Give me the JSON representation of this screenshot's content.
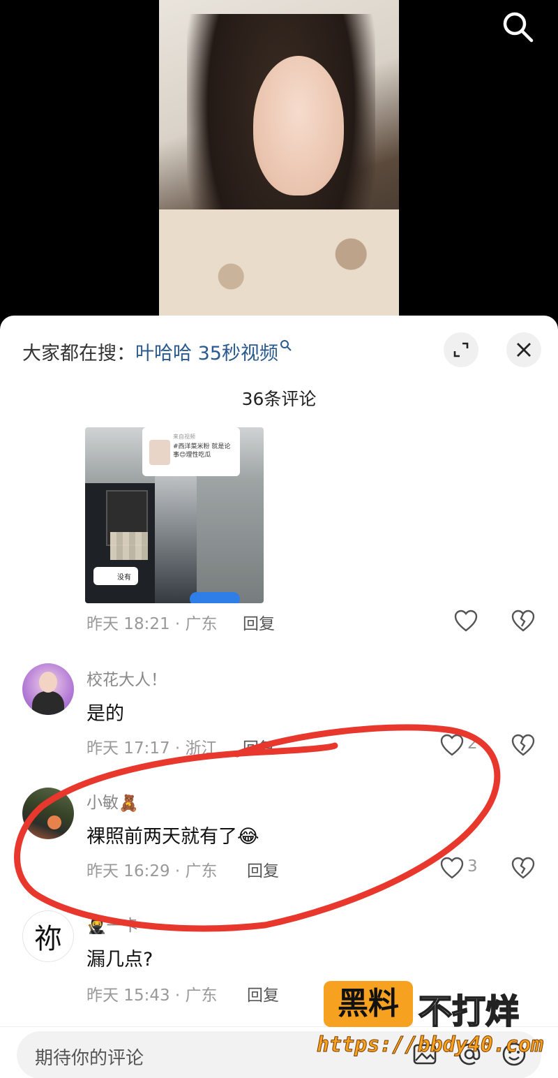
{
  "search_bar": {
    "prefix": "大家都在搜：",
    "query": "叶哈哈 35秒视频"
  },
  "comments_header": {
    "count_title": "36条评论"
  },
  "comments": [
    {
      "id": "c0",
      "username": "",
      "text": "",
      "thumbnail": {
        "card_source": "来自视频",
        "card_text": "#西洋菜米粉 就是论事😊理性吃瓜",
        "chip_text": "没有"
      },
      "time_location": "昨天 18:21 · 广东",
      "reply_label": "回复",
      "likes": ""
    },
    {
      "id": "c1",
      "username": "校花大人！",
      "text": "是的",
      "time_location": "昨天 17:17 · 浙江",
      "reply_label": "回复",
      "likes": "2"
    },
    {
      "id": "c2",
      "username": "小敏",
      "username_emoji": "🧸",
      "text": "裸照前两天就有了",
      "text_emoji": "😂",
      "time_location": "昨天 16:29 · 广东",
      "reply_label": "回复",
      "likes": "3"
    },
    {
      "id": "c3",
      "username": "一卡",
      "username_emoji": "🥷",
      "avatar_glyph": "祢",
      "text": "漏几点?",
      "time_location": "昨天 15:43 · 广东",
      "reply_label": "回复",
      "likes": ""
    }
  ],
  "input": {
    "placeholder": "期待你的评论"
  },
  "watermark": {
    "badge": "黑料",
    "right": "不打烊",
    "url": "https://bbdy40.com"
  },
  "colors": {
    "link": "#2a5a8f",
    "annotation_red": "#e8372c",
    "watermark_orange": "#f7a120"
  },
  "icons": [
    "search-icon",
    "expand-icon",
    "close-icon",
    "heart-icon",
    "broken-heart-icon",
    "image-icon",
    "at-icon",
    "emoji-icon"
  ]
}
